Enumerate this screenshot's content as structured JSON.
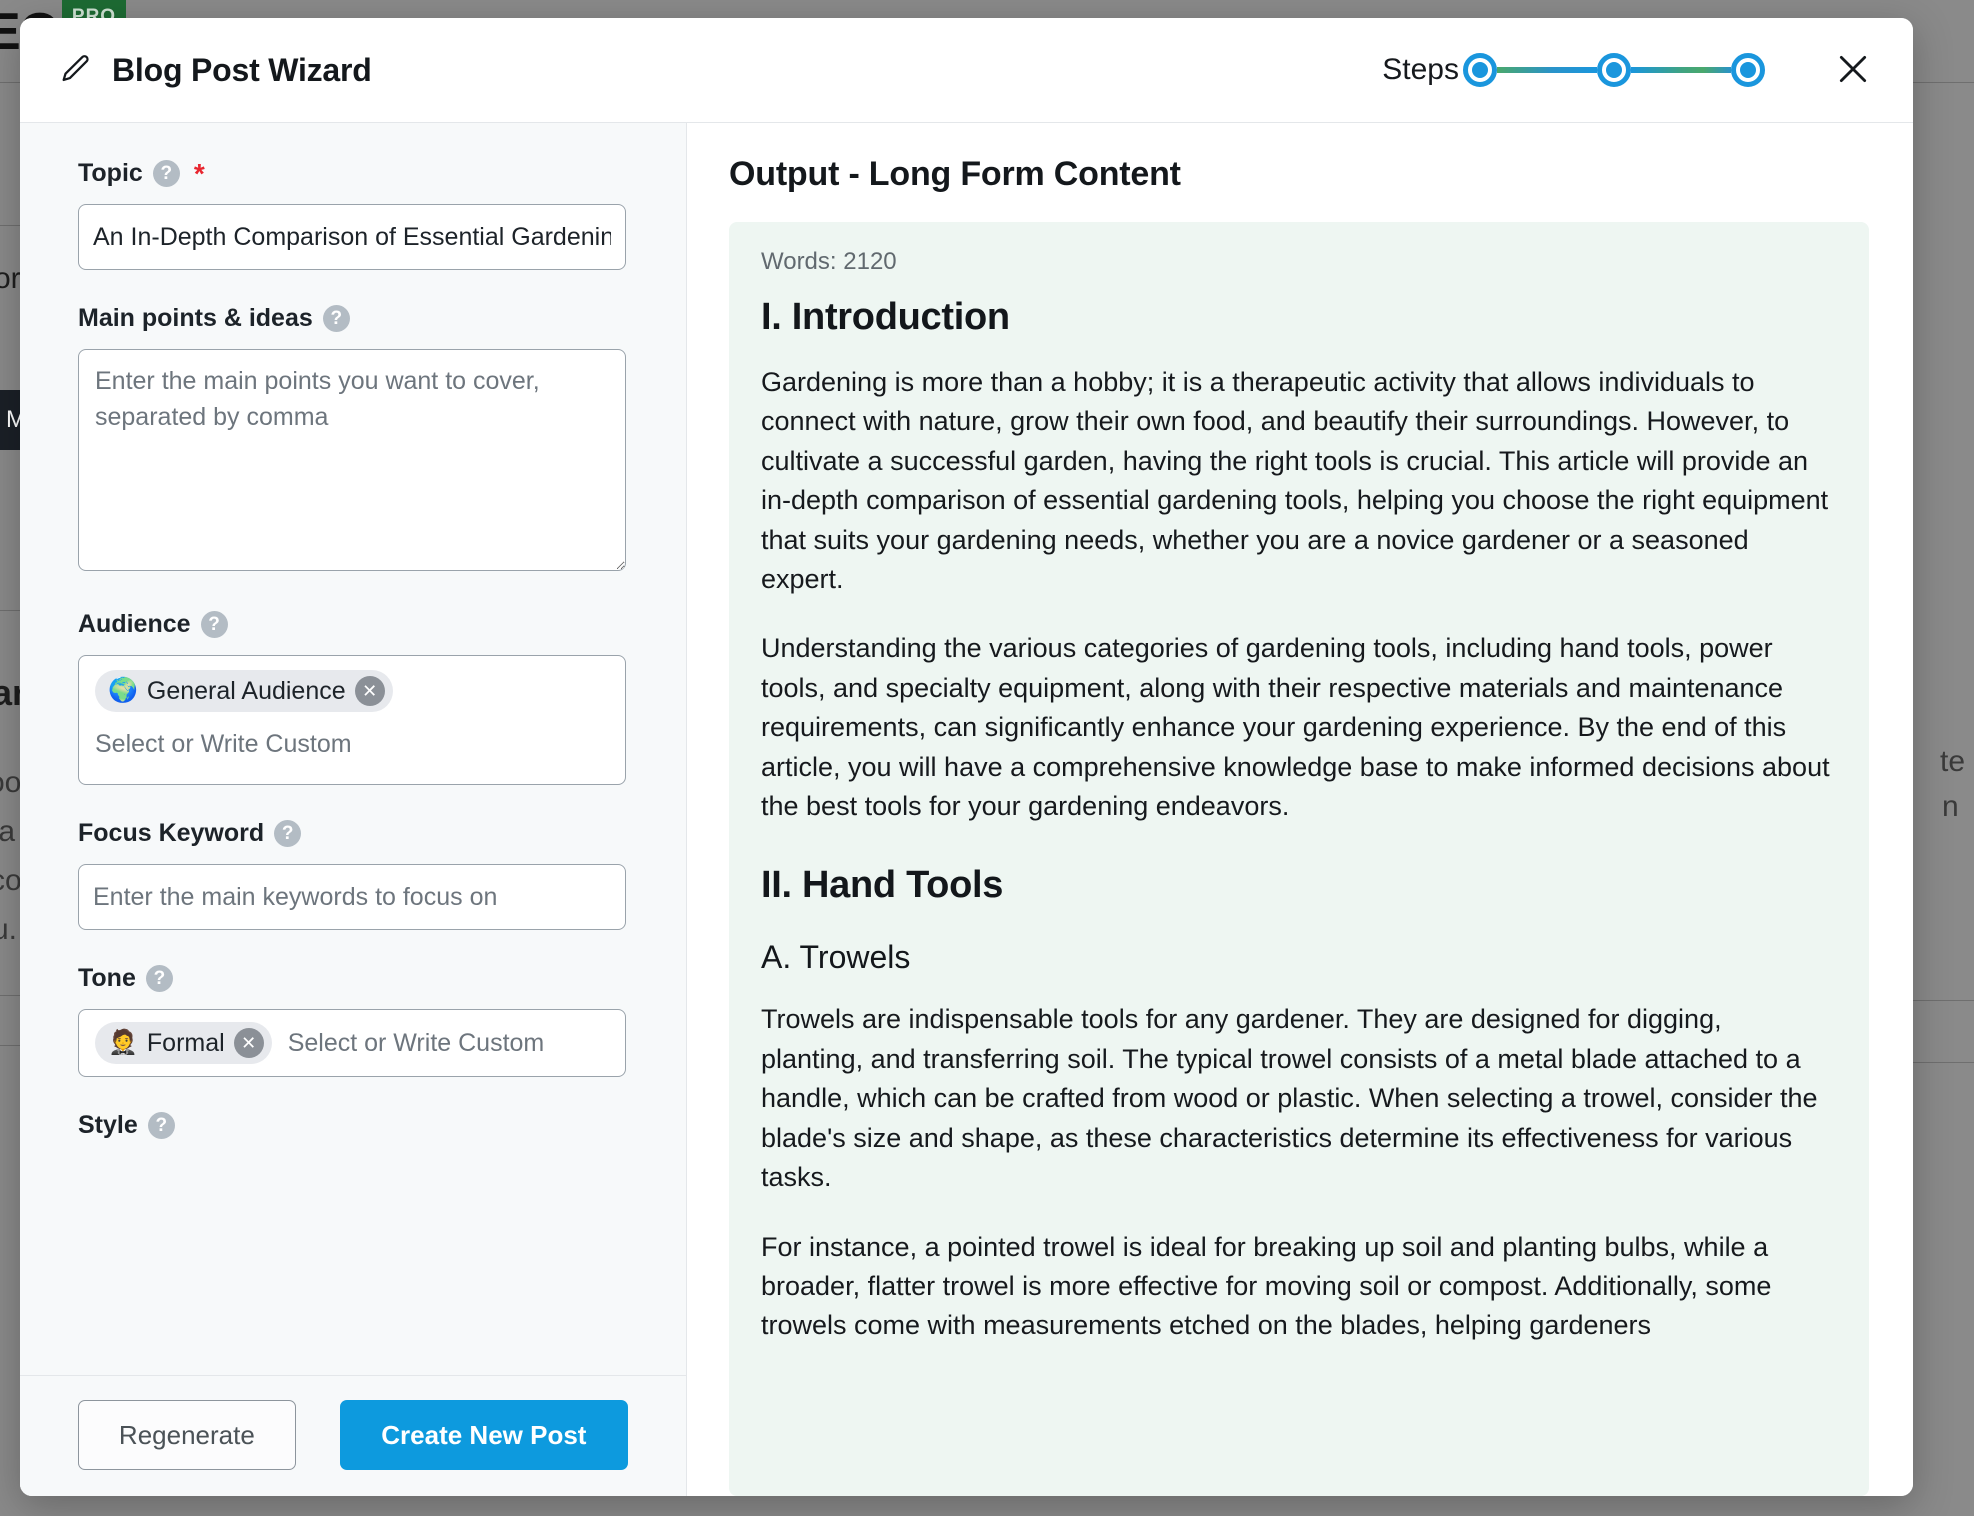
{
  "background": {
    "brand_text": "EO",
    "pro_badge": "PRO",
    "fragments": [
      "or",
      "ar",
      "oo",
      "ta",
      "co",
      "u.",
      "M",
      "te",
      "n"
    ]
  },
  "header": {
    "title": "Blog Post Wizard",
    "pencil_icon": "pencil-icon",
    "steps_label": "Steps",
    "close_icon": "close-icon",
    "steps": [
      {
        "index": 1,
        "state": "active"
      },
      {
        "index": 2,
        "state": "active"
      },
      {
        "index": 3,
        "state": "active"
      }
    ],
    "accent_color": "#1a96dd",
    "line_gradient_from": "#4aa86c",
    "line_gradient_to": "#1a96dd"
  },
  "form": {
    "help_icon_glyph": "?",
    "required_marker": "*",
    "fields": {
      "topic": {
        "label": "Topic",
        "value": "An In-Depth Comparison of Essential Gardening Tools",
        "required": true
      },
      "main_points": {
        "label": "Main points & ideas",
        "value": "",
        "placeholder": "Enter the main points you want to cover, separated by comma"
      },
      "audience": {
        "label": "Audience",
        "placeholder": "Select or Write Custom",
        "tokens": [
          {
            "emoji": "🌍",
            "label": "General Audience",
            "remove_icon": "close-icon"
          }
        ]
      },
      "focus_keyword": {
        "label": "Focus Keyword",
        "value": "",
        "placeholder": "Enter the main keywords to focus on"
      },
      "tone": {
        "label": "Tone",
        "placeholder": "Select or Write Custom",
        "tokens": [
          {
            "emoji": "🤵",
            "label": "Formal",
            "remove_icon": "close-icon"
          }
        ]
      },
      "style": {
        "label": "Style"
      }
    },
    "footer": {
      "regenerate_label": "Regenerate",
      "create_label": "Create New Post",
      "create_color": "#0d9ade"
    }
  },
  "output": {
    "title": "Output - Long Form Content",
    "words_label": "Words: 2120",
    "card_color": "#eef6f2",
    "blocks": [
      {
        "type": "h2",
        "text": "I. Introduction"
      },
      {
        "type": "p",
        "text": "Gardening is more than a hobby; it is a therapeutic activity that allows individuals to connect with nature, grow their own food, and beautify their surroundings. However, to cultivate a successful garden, having the right tools is crucial. This article will provide an in-depth comparison of essential gardening tools, helping you choose the right equipment that suits your gardening needs, whether you are a novice gardener or a seasoned expert."
      },
      {
        "type": "p",
        "text": "Understanding the various categories of gardening tools, including hand tools, power tools, and specialty equipment, along with their respective materials and maintenance requirements, can significantly enhance your gardening experience. By the end of this article, you will have a comprehensive knowledge base to make informed decisions about the best tools for your gardening endeavors."
      },
      {
        "type": "h2",
        "text": "II. Hand Tools"
      },
      {
        "type": "h3",
        "text": "A. Trowels"
      },
      {
        "type": "p",
        "text": "Trowels are indispensable tools for any gardener. They are designed for digging, planting, and transferring soil. The typical trowel consists of a metal blade attached to a handle, which can be crafted from wood or plastic. When selecting a trowel, consider the blade's size and shape, as these characteristics determine its effectiveness for various tasks."
      },
      {
        "type": "p",
        "text": "For instance, a pointed trowel is ideal for breaking up soil and planting bulbs, while a broader, flatter trowel is more effective for moving soil or compost. Additionally, some trowels come with measurements etched on the blades, helping gardeners"
      }
    ]
  }
}
